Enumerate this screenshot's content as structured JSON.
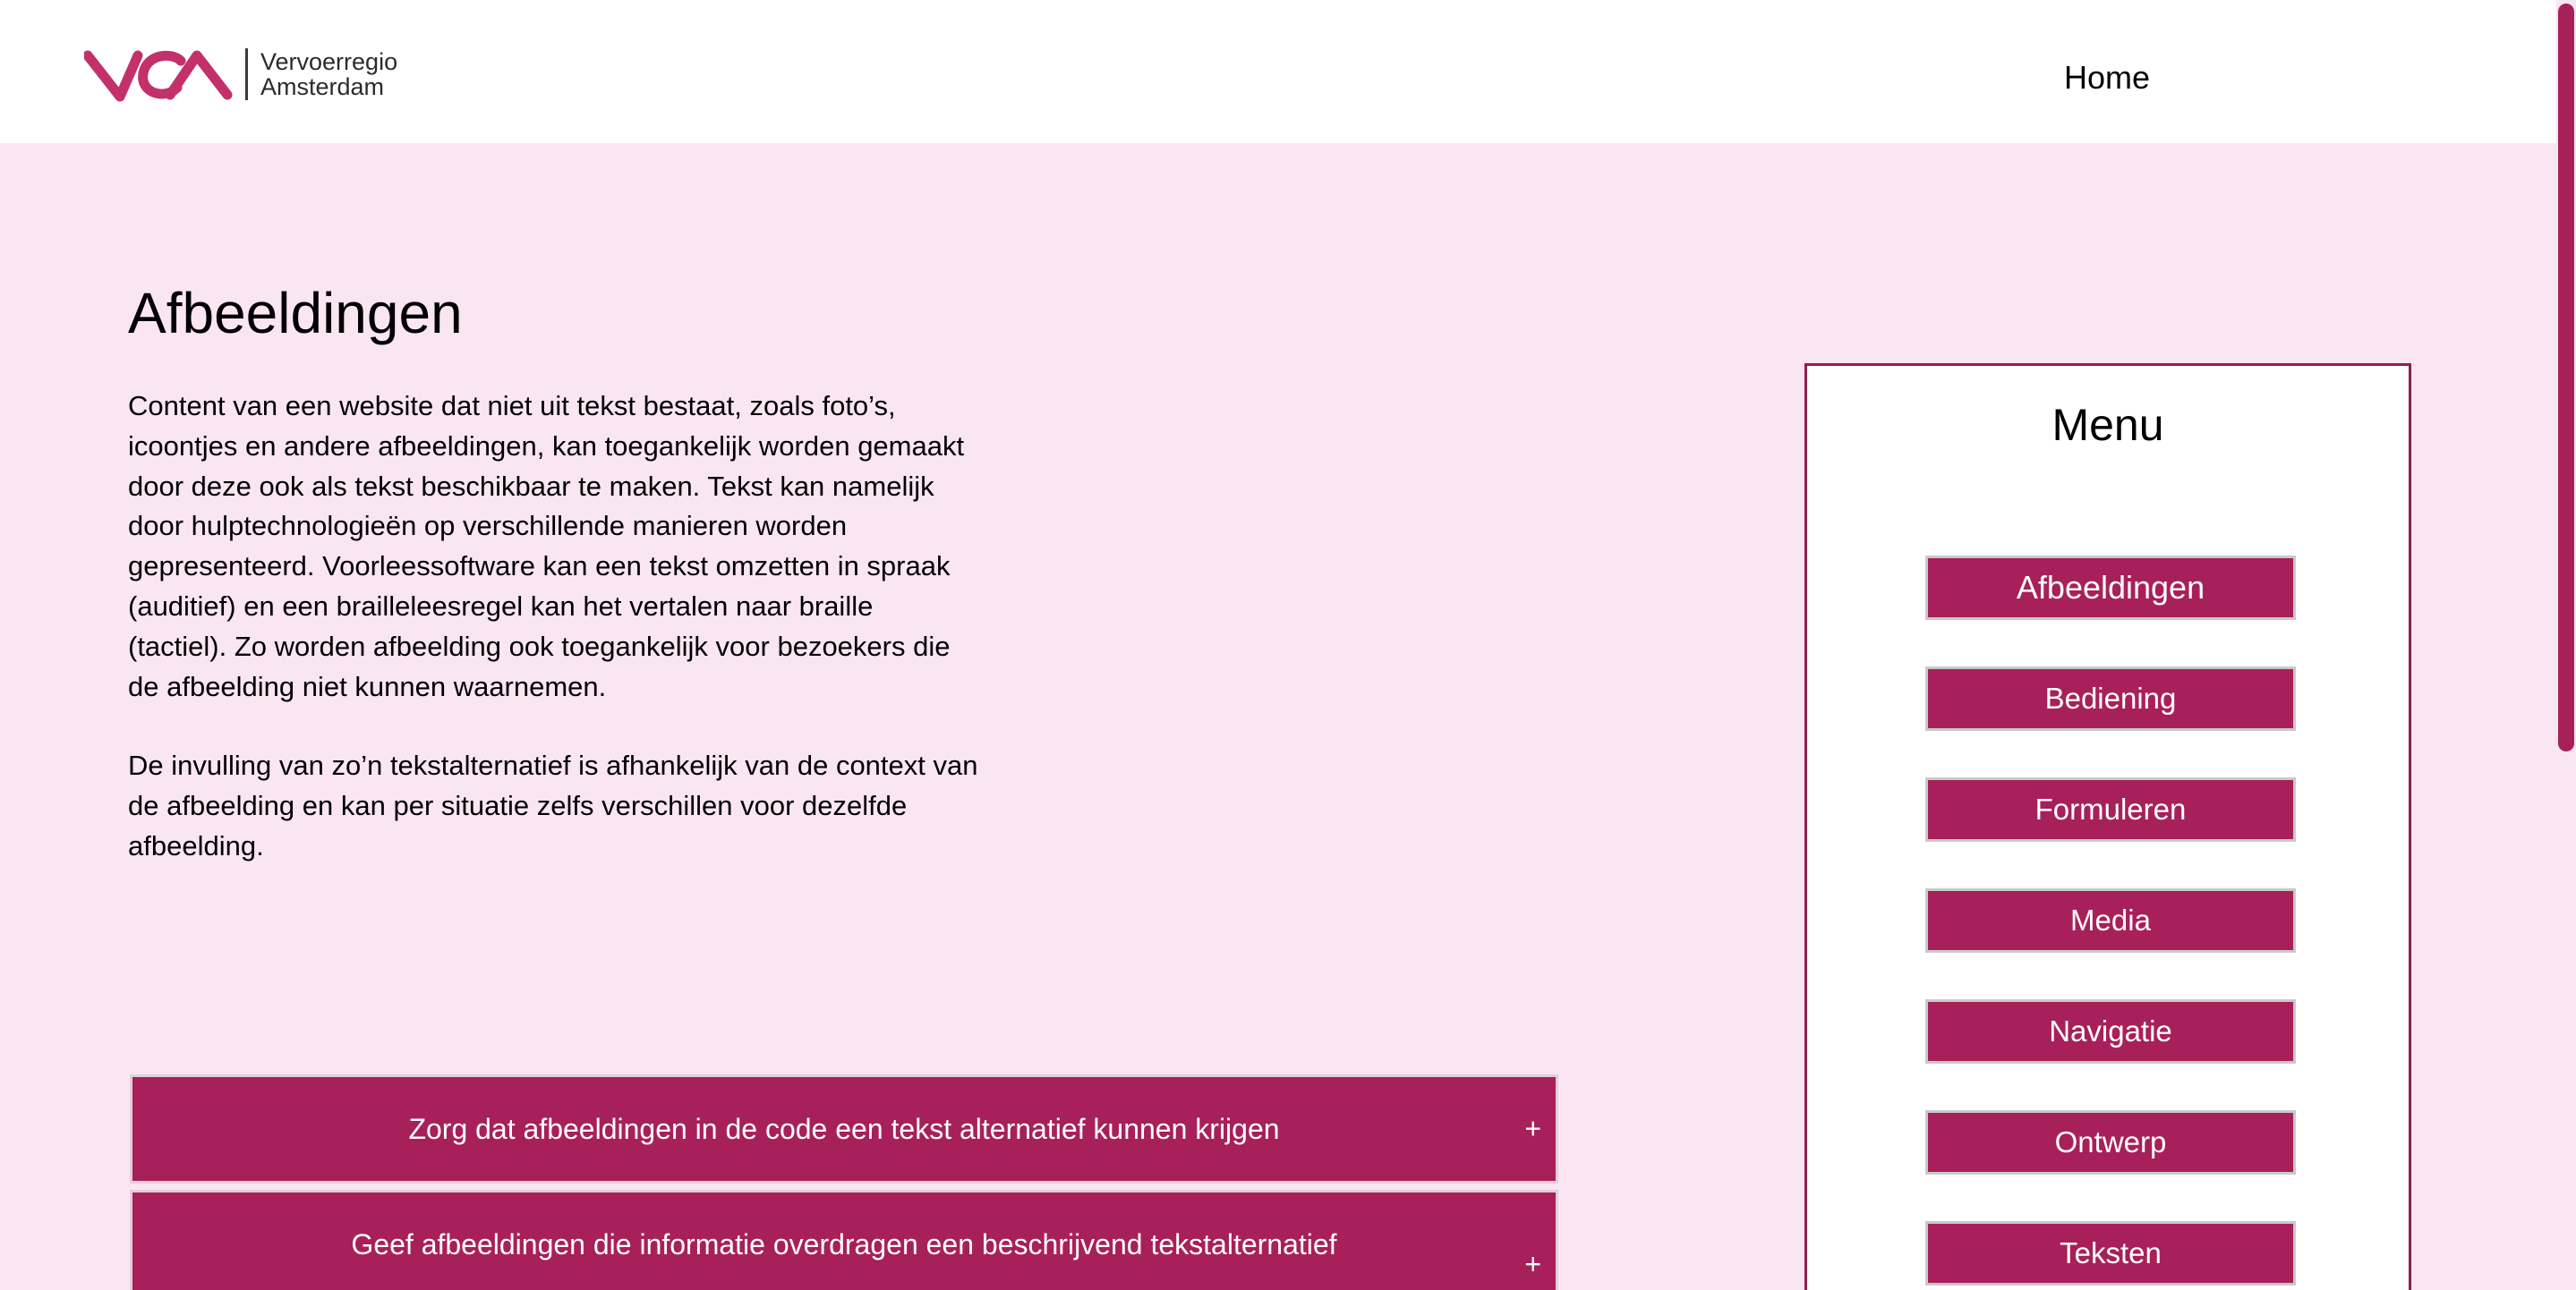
{
  "header": {
    "logo": {
      "line1": "Vervoerregio",
      "line2": "Amsterdam",
      "mark_color": "#c4306a",
      "icon": "vra-logo-icon"
    },
    "nav_home": "Home"
  },
  "main": {
    "title": "Afbeeldingen",
    "paragraphs": [
      "Content van een website dat niet uit tekst bestaat, zoals foto’s, icoontjes en andere afbeeldingen, kan toegankelijk worden gemaakt door deze ook als tekst beschikbaar te maken. Tekst kan namelijk door hulptechnologieën op verschillende manieren worden gepresenteerd. Voorleessoftware kan een tekst omzetten in spraak (auditief) en een brailleleesregel kan het vertalen naar braille (tactiel). Zo worden afbeelding ook toegankelijk voor bezoekers die de afbeelding niet kunnen waarnemen.",
      "De invulling van zo’n tekstalternatief is afhankelijk van de context van de afbeelding en kan per situatie zelfs verschillen voor dezelfde afbeelding."
    ],
    "accordions": [
      {
        "label": "Zorg dat afbeeldingen in de code een tekst alternatief kunnen krijgen",
        "toggle": "+"
      },
      {
        "label": "Geef afbeeldingen die informatie overdragen een beschrijvend tekstalternatief",
        "toggle": "+"
      }
    ]
  },
  "menu": {
    "title": "Menu",
    "items": [
      {
        "label": "Afbeeldingen"
      },
      {
        "label": "Bediening"
      },
      {
        "label": "Formuleren"
      },
      {
        "label": "Media"
      },
      {
        "label": "Navigatie"
      },
      {
        "label": "Ontwerp"
      },
      {
        "label": "Teksten"
      }
    ]
  },
  "colors": {
    "accent": "#a82059",
    "background": "#f9e6f1",
    "menu_border": "#8e1e51"
  }
}
